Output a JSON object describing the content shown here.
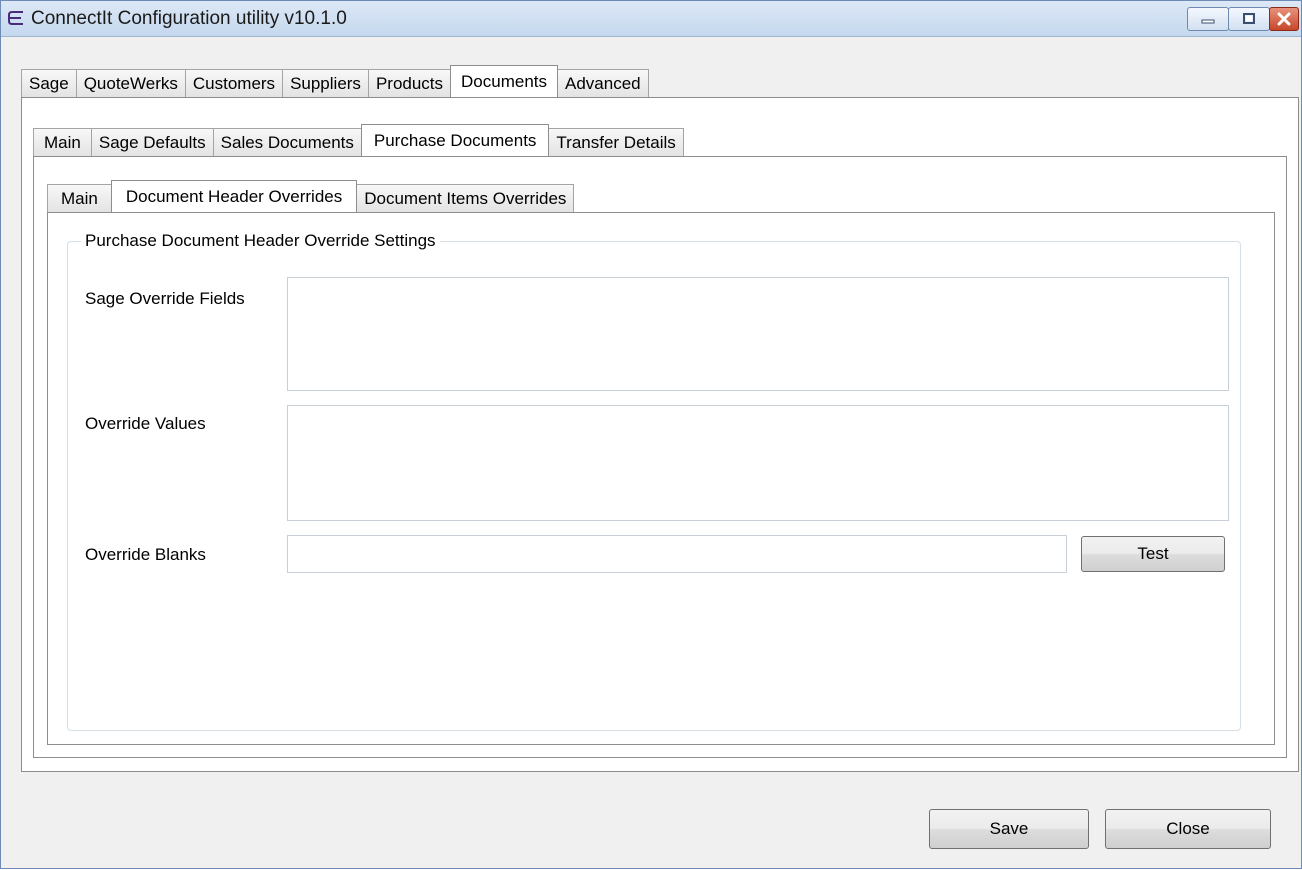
{
  "window": {
    "title": "ConnectIt Configuration utility v10.1.0"
  },
  "main_tabs": [
    "Sage",
    "QuoteWerks",
    "Customers",
    "Suppliers",
    "Products",
    "Documents",
    "Advanced"
  ],
  "documents_tabs": [
    "Main",
    "Sage Defaults",
    "Sales Documents",
    "Purchase Documents",
    "Transfer Details"
  ],
  "purchase_tabs": [
    "Main",
    "Document Header Overrides",
    "Document Items Overrides"
  ],
  "group": {
    "title": "Purchase Document Header Override Settings",
    "sage_override_fields_label": "Sage Override Fields",
    "sage_override_fields_value": "",
    "override_values_label": "Override Values",
    "override_values_value": "",
    "override_blanks_label": "Override Blanks",
    "override_blanks_value": "",
    "test_label": "Test"
  },
  "footer": {
    "save_label": "Save",
    "close_label": "Close"
  },
  "icons": {
    "app": "app-icon",
    "minimize": "minimize-icon",
    "maximize": "maximize-icon",
    "close": "close-icon"
  }
}
